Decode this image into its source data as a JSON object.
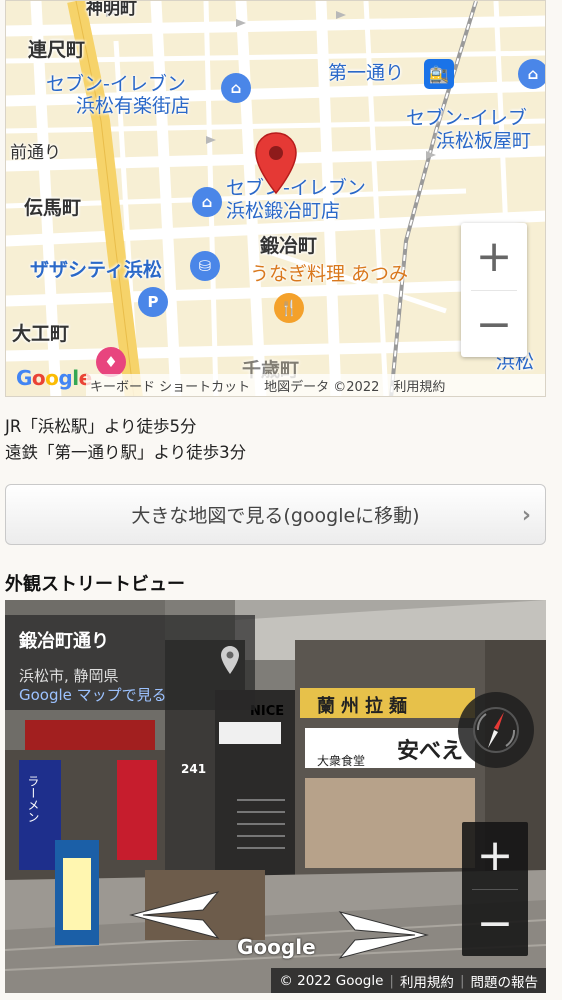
{
  "map": {
    "labels": {
      "kanda": "神明町",
      "renjaku": "連尺町",
      "seven_yurakugai": "セブン-イレブン",
      "seven_yurakugai_2": "浜松有楽街店",
      "daiichi_dori": "第一通り",
      "seven_itaya": "セブン-イレブ",
      "seven_itaya_2": "浜松板屋町",
      "mae_dori": "前通り",
      "denma": "伝馬町",
      "seven_kajimachi": "セブン-イレブン",
      "seven_kajimachi_2": "浜松鍛冶町店",
      "kajimachi": "鍛冶町",
      "zaza": "ザザシティ浜松",
      "unagi": "うなぎ料理 あつみ",
      "daiku": "大工町",
      "hamamatsu_right": "浜松",
      "chitose": "千歳町",
      "parking": "P"
    },
    "zoom_in": "+",
    "zoom_out": "−",
    "footer": {
      "shortcuts": "キーボード ショートカット",
      "map_data": "地図データ ©2022",
      "terms": "利用規約"
    },
    "logo": "Google"
  },
  "access": {
    "line1": "JR「浜松駅」より徒歩5分",
    "line2": "遠鉄「第一通り駅」より徒歩3分"
  },
  "big_map_button": {
    "label": "大きな地図で見る(googleに移動)",
    "chevron": "›"
  },
  "section": {
    "title": "外観ストリートビュー"
  },
  "street_view": {
    "title": "鍛冶町通り",
    "subtitle": "浜松市, 静岡県",
    "link": "Google マップで見る",
    "zoom_in": "+",
    "zoom_out": "−",
    "logo": "Google",
    "footer": {
      "copyright": "© 2022 Google",
      "terms": "利用規約",
      "report": "問題の報告"
    },
    "signs": {
      "ranshu": "蘭州拉麺",
      "yasube": "安べえ",
      "taishu": "大衆食堂",
      "nice": "NICE",
      "number": "241",
      "ramen": "ラーメン"
    }
  },
  "colors": {
    "map_bg": "#f7efd4",
    "road_major": "#f6d36a",
    "poi_blue": "#4a86e8",
    "poi_orange": "#f4a12b",
    "pin_red": "#e53935",
    "link_blue": "#9cc2ff"
  }
}
